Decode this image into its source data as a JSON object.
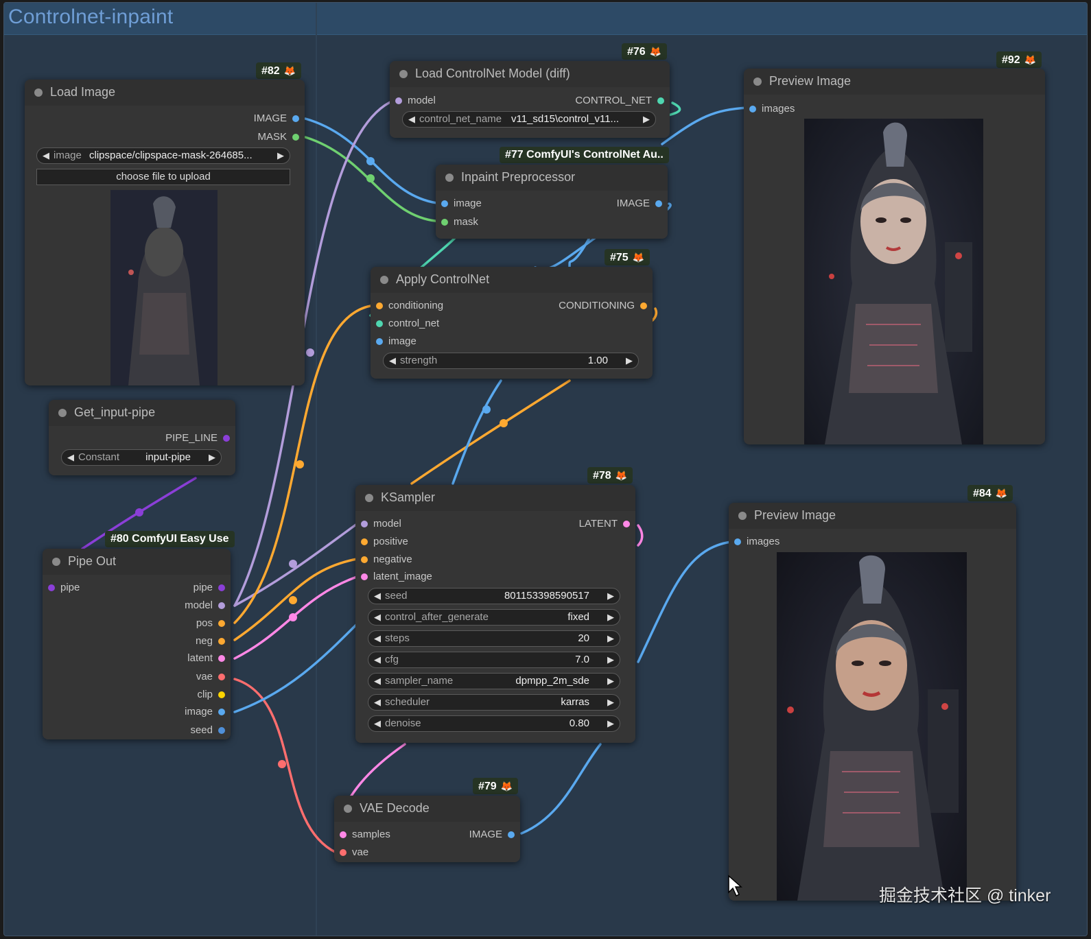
{
  "group": {
    "title": "Controlnet-inpaint"
  },
  "nodes": {
    "load_image": {
      "badge": "#82",
      "title": "Load Image",
      "outputs": [
        "IMAGE",
        "MASK"
      ],
      "image_widget": {
        "label": "image",
        "value": "clipspace/clipspace-mask-264685..."
      },
      "upload_label": "choose file to upload"
    },
    "load_controlnet": {
      "badge": "#76",
      "title": "Load ControlNet Model (diff)",
      "inputs": [
        "model"
      ],
      "outputs": [
        "CONTROL_NET"
      ],
      "widget": {
        "label": "control_net_name",
        "value": "v11_sd15\\control_v11..."
      }
    },
    "preview_top": {
      "badge": "#92",
      "title": "Preview Image",
      "inputs": [
        "images"
      ]
    },
    "inpaint_preprocessor": {
      "badge": "#77 ComfyUI's ControlNet Au..",
      "title": "Inpaint Preprocessor",
      "inputs": [
        "image",
        "mask"
      ],
      "outputs": [
        "IMAGE"
      ]
    },
    "apply_controlnet": {
      "badge": "#75",
      "title": "Apply ControlNet",
      "inputs": [
        "conditioning",
        "control_net",
        "image"
      ],
      "outputs": [
        "CONDITIONING"
      ],
      "widget": {
        "label": "strength",
        "value": "1.00"
      }
    },
    "get_input_pipe": {
      "title": "Get_input-pipe",
      "outputs": [
        "PIPE_LINE"
      ],
      "widget": {
        "label": "Constant",
        "value": "input-pipe"
      }
    },
    "pipe_out": {
      "badge": "#80 ComfyUI Easy Use",
      "title": "Pipe Out",
      "inputs": [
        "pipe"
      ],
      "outputs": [
        "pipe",
        "model",
        "pos",
        "neg",
        "latent",
        "vae",
        "clip",
        "image",
        "seed"
      ]
    },
    "ksampler": {
      "badge": "#78",
      "title": "KSampler",
      "inputs": [
        "model",
        "positive",
        "negative",
        "latent_image"
      ],
      "outputs": [
        "LATENT"
      ],
      "widgets": [
        {
          "label": "seed",
          "value": "801153398590517"
        },
        {
          "label": "control_after_generate",
          "value": "fixed"
        },
        {
          "label": "steps",
          "value": "20"
        },
        {
          "label": "cfg",
          "value": "7.0"
        },
        {
          "label": "sampler_name",
          "value": "dpmpp_2m_sde"
        },
        {
          "label": "scheduler",
          "value": "karras"
        },
        {
          "label": "denoise",
          "value": "0.80"
        }
      ]
    },
    "preview_bottom": {
      "badge": "#84",
      "title": "Preview Image",
      "inputs": [
        "images"
      ]
    },
    "vae_decode": {
      "badge": "#79",
      "title": "VAE Decode",
      "inputs": [
        "samples",
        "vae"
      ],
      "outputs": [
        "IMAGE"
      ]
    }
  },
  "watermark": "掘金技术社区 @ tinker",
  "colors": {
    "image": "#5aa9ef",
    "mask": "#6fd070",
    "model": "#b39ddb",
    "control_net": "#4fd6b0",
    "conditioning": "#ffa931",
    "latent": "#ff88e6",
    "vae": "#ff6e6e",
    "clip": "#ffd500",
    "pipe": "#8b3fd8",
    "seed": "#4f8fd8"
  }
}
